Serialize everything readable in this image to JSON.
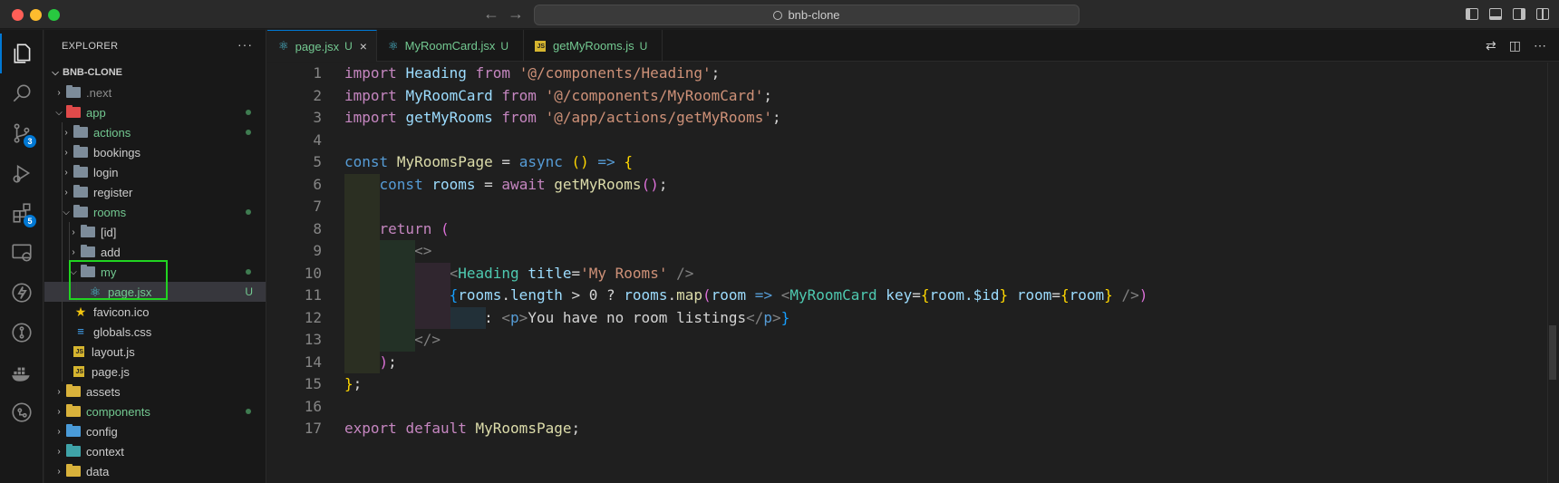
{
  "window": {
    "title": "bnb-clone"
  },
  "activity": {
    "scm_badge": "3",
    "extensions_badge": "5"
  },
  "explorer": {
    "header": "EXPLORER",
    "more": "···",
    "project": "BNB-CLONE",
    "items": [
      {
        "name": ".next",
        "type": "folder"
      },
      {
        "name": "app",
        "type": "folder"
      },
      {
        "name": "actions",
        "type": "folder"
      },
      {
        "name": "bookings",
        "type": "folder"
      },
      {
        "name": "login",
        "type": "folder"
      },
      {
        "name": "register",
        "type": "folder"
      },
      {
        "name": "rooms",
        "type": "folder"
      },
      {
        "name": "[id]",
        "type": "folder"
      },
      {
        "name": "add",
        "type": "folder"
      },
      {
        "name": "my",
        "type": "folder"
      },
      {
        "name": "page.jsx",
        "type": "file",
        "status": "U"
      },
      {
        "name": "favicon.ico",
        "type": "file"
      },
      {
        "name": "globals.css",
        "type": "file"
      },
      {
        "name": "layout.js",
        "type": "file"
      },
      {
        "name": "page.js",
        "type": "file"
      },
      {
        "name": "assets",
        "type": "folder"
      },
      {
        "name": "components",
        "type": "folder"
      },
      {
        "name": "config",
        "type": "folder"
      },
      {
        "name": "context",
        "type": "folder"
      },
      {
        "name": "data",
        "type": "folder"
      }
    ]
  },
  "tabs": [
    {
      "label": "page.jsx",
      "status": "U",
      "active": true
    },
    {
      "label": "MyRoomCard.jsx",
      "status": "U",
      "active": false
    },
    {
      "label": "getMyRooms.js",
      "status": "U",
      "active": false
    }
  ],
  "editor": {
    "line_numbers": [
      "1",
      "2",
      "3",
      "4",
      "5",
      "6",
      "7",
      "8",
      "9",
      "10",
      "11",
      "12",
      "13",
      "14",
      "15",
      "16",
      "17"
    ],
    "lines": {
      "l1": {
        "kw": "import",
        "id": "Heading",
        "from": "from",
        "str": "'@/components/Heading'",
        "end": ";"
      },
      "l2": {
        "kw": "import",
        "id": "MyRoomCard",
        "from": "from",
        "str": "'@/components/MyRoomCard'",
        "end": ";"
      },
      "l3": {
        "kw": "import",
        "id": "getMyRooms",
        "from": "from",
        "str": "'@/app/actions/getMyRooms'",
        "end": ";"
      },
      "l5": {
        "kw": "const",
        "id": "MyRoomsPage",
        "eq": " = ",
        "async": "async",
        "paren": "()",
        "arrow": "=>",
        "brace": "{"
      },
      "l6": {
        "kw": "const",
        "id": "rooms",
        "eq": " = ",
        "await": "await",
        "fn": "getMyRooms",
        "paren": "()",
        "end": ";"
      },
      "l8": {
        "kw": "return",
        "paren": "("
      },
      "l9": {
        "frag": "<>"
      },
      "l10": {
        "open": "<",
        "tag": "Heading",
        "attr": "title",
        "eq": "=",
        "str": "'My Rooms'",
        "close": " />"
      },
      "l11": {
        "b1": "{",
        "var1": "rooms",
        "dot1": ".",
        "prop": "length",
        "op": " > 0 ? ",
        "var2": "rooms",
        "dot2": ".",
        "fn": "map",
        "p1": "(",
        "param": "room",
        "arrow": " => ",
        "lt": "<",
        "tag": "MyRoomCard",
        "attr1": " key",
        "eq1": "=",
        "b2": "{",
        "expr1": "room.$id",
        "b3": "}",
        "attr2": " room",
        "eq2": "=",
        "b4": "{",
        "expr2": "room",
        "b5": "}",
        "sc": " />",
        "p2": ")"
      },
      "l12": {
        "colon": ": ",
        "lt": "<",
        "tag": "p",
        "gt": ">",
        "text": "You have no room listings",
        "lt2": "</",
        "tag2": "p",
        "gt2": ">",
        "b": "}"
      },
      "l13": {
        "frag": "</>"
      },
      "l14": {
        "paren": ")",
        "end": ";"
      },
      "l15": {
        "brace": "}",
        "end": ";"
      },
      "l17": {
        "kw": "export",
        "def": "default",
        "id": "MyRoomsPage",
        "end": ";"
      }
    }
  }
}
